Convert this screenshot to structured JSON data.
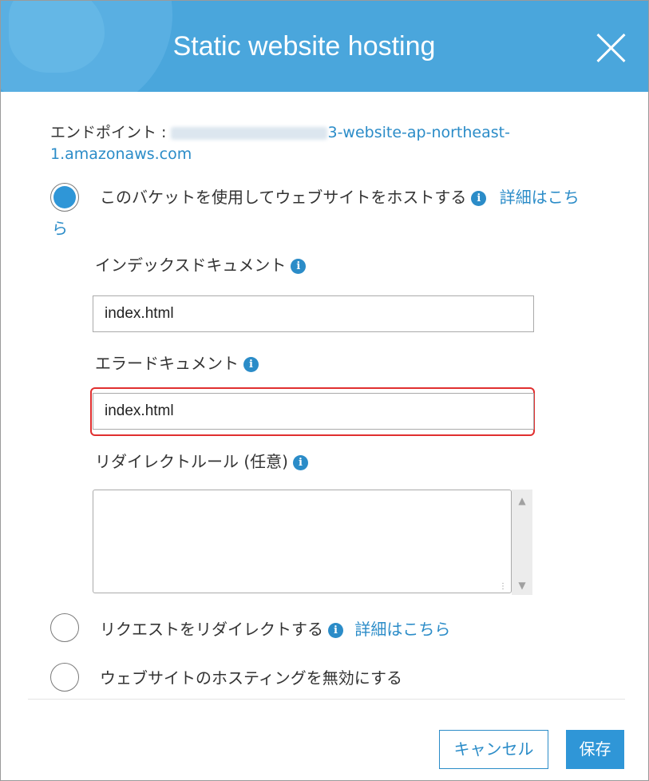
{
  "dialog": {
    "title": "Static website hosting"
  },
  "endpoint": {
    "label": "エンドポイント : ",
    "url_visible_part1": "3-website-ap-northeast-",
    "url_visible_part2": "1.amazonaws.com"
  },
  "options": {
    "host": {
      "label": "このバケットを使用してウェブサイトをホストする",
      "more_link_part1": "詳細はこち",
      "more_link_part2": "ら",
      "selected": true
    },
    "redirect": {
      "label": "リクエストをリダイレクトする",
      "more_link": "詳細はこちら",
      "selected": false
    },
    "disable": {
      "label": "ウェブサイトのホスティングを無効にする",
      "selected": false
    }
  },
  "fields": {
    "index_document": {
      "label": "インデックスドキュメント",
      "value": "index.html"
    },
    "error_document": {
      "label": "エラードキュメント",
      "value": "index.html"
    },
    "redirect_rules": {
      "label": "リダイレクトルール (任意)",
      "value": ""
    }
  },
  "buttons": {
    "cancel": "キャンセル",
    "save": "保存"
  },
  "icons": {
    "info": "i"
  },
  "colors": {
    "header_bg": "#4aa6dc",
    "accent": "#2b8cc8",
    "highlight_border": "#e03030"
  }
}
